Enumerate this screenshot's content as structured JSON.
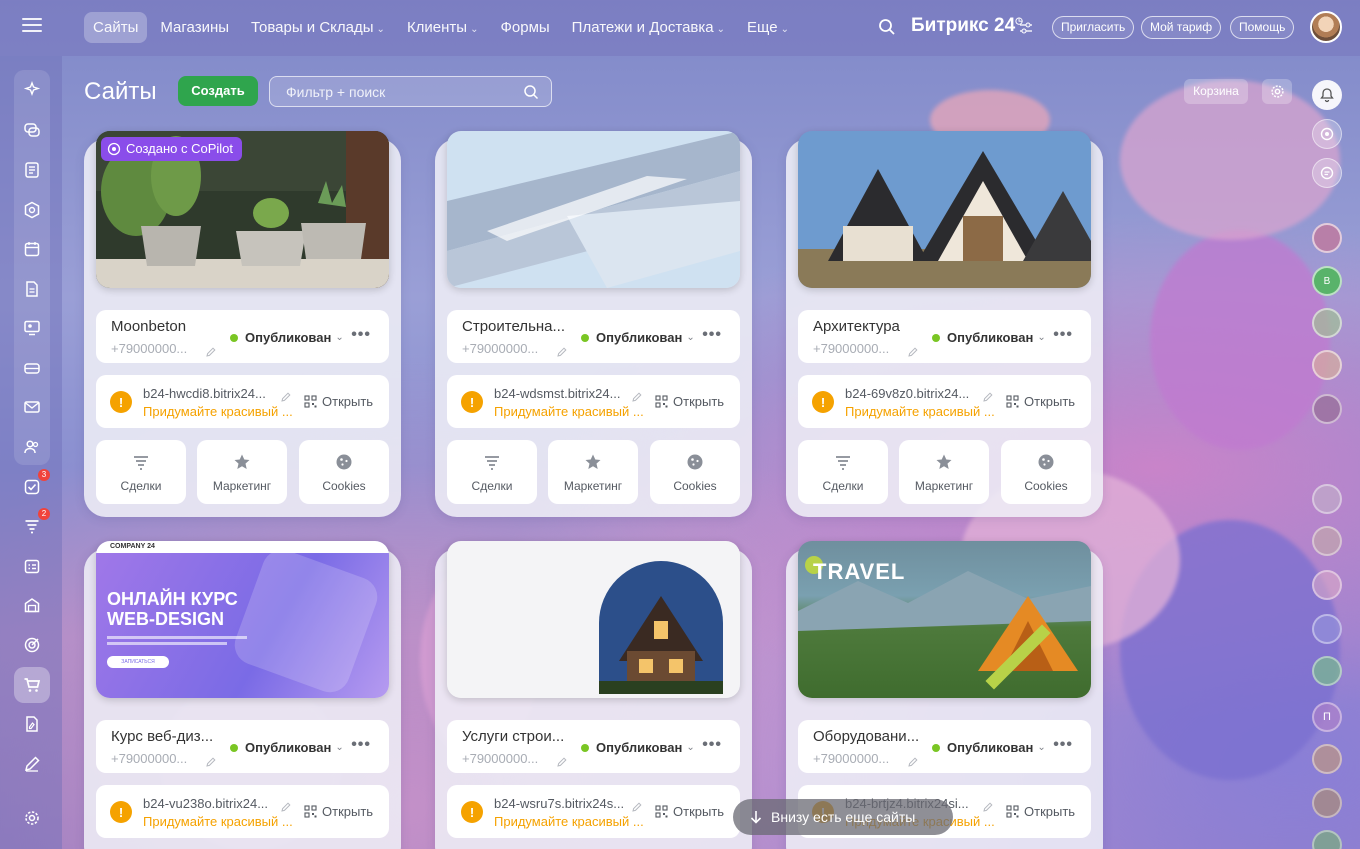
{
  "topbar": {
    "nav": [
      {
        "label": "Сайты",
        "active": true,
        "has_menu": false
      },
      {
        "label": "Магазины",
        "active": false,
        "has_menu": false
      },
      {
        "label": "Товары и Склады",
        "active": false,
        "has_menu": true
      },
      {
        "label": "Клиенты",
        "active": false,
        "has_menu": true
      },
      {
        "label": "Формы",
        "active": false,
        "has_menu": false
      },
      {
        "label": "Платежи и Доставка",
        "active": false,
        "has_menu": true
      },
      {
        "label": "Еще",
        "active": false,
        "has_menu": true
      }
    ],
    "brand": "Битрикс 24",
    "invite": "Пригласить",
    "tariff": "Мой тариф",
    "help": "Помощь"
  },
  "page": {
    "title": "Сайты",
    "create": "Создать",
    "search_placeholder": "Фильтр + поиск",
    "trash": "Корзина"
  },
  "sidebar": {
    "icons": [
      "sparkles-icon",
      "chat-icon",
      "feed-icon",
      "hexagon-icon",
      "calendar-icon",
      "document-icon",
      "video-board-icon",
      "drive-icon",
      "mail-icon",
      "contacts-icon",
      "tasks-icon",
      "crm-funnel-icon",
      "booking-icon",
      "inventory-icon",
      "target-icon",
      "shop-icon",
      "sign-icon",
      "pen-icon"
    ],
    "badges": {
      "tasks-icon": "3",
      "crm-funnel-icon": "2"
    },
    "active": "shop-icon",
    "settings_icon": "gear-icon"
  },
  "sites": [
    {
      "title": "Moonbeton",
      "phone": "+79000000...",
      "status": "Опубликован",
      "domain": "b24-hwcdi8.bitrix24...",
      "hint": "Придумайте красивый ...",
      "copilot": "Создано с CoPilot",
      "thumb": "plants"
    },
    {
      "title": "Строительна...",
      "phone": "+79000000...",
      "status": "Опубликован",
      "domain": "b24-wdsmst.bitrix24...",
      "hint": "Придумайте красивый ...",
      "thumb": "facade"
    },
    {
      "title": "Архитектура",
      "phone": "+79000000...",
      "status": "Опубликован",
      "domain": "b24-69v8z0.bitrix24...",
      "hint": "Придумайте красивый ...",
      "thumb": "houses"
    },
    {
      "title": "Курс веб-диз...",
      "phone": "+79000000...",
      "status": "Опубликован",
      "domain": "b24-vu238o.bitrix24...",
      "hint": "Придумайте красивый ...",
      "thumb": "course",
      "thumb_texts": {
        "company": "COMPANY 24",
        "line1": "ОНЛАЙН КУРС",
        "line2": "WEB-DESIGN",
        "button": "ЗАПИСАТЬСЯ"
      }
    },
    {
      "title": "Услуги строи...",
      "phone": "+79000000...",
      "status": "Опубликован",
      "domain": "b24-wsru7s.bitrix24s...",
      "hint": "Придумайте красивый ...",
      "thumb": "house-night"
    },
    {
      "title": "Оборудовани...",
      "phone": "+79000000...",
      "status": "Опубликован",
      "domain": "b24-brtjz4.bitrix24si...",
      "hint": "Придумайте красивый ...",
      "thumb": "travel",
      "thumb_texts": {
        "headline": "TRAVEL"
      }
    }
  ],
  "card_labels": {
    "open": "Открыть",
    "deals": "Сделки",
    "marketing": "Маркетинг",
    "cookies": "Cookies"
  },
  "toast": "Внизу есть еще сайты",
  "colors": {
    "accent_green": "#2fa54d",
    "status_green": "#7ac624",
    "warning": "#f5a200",
    "copilot": "#8a4dea"
  }
}
